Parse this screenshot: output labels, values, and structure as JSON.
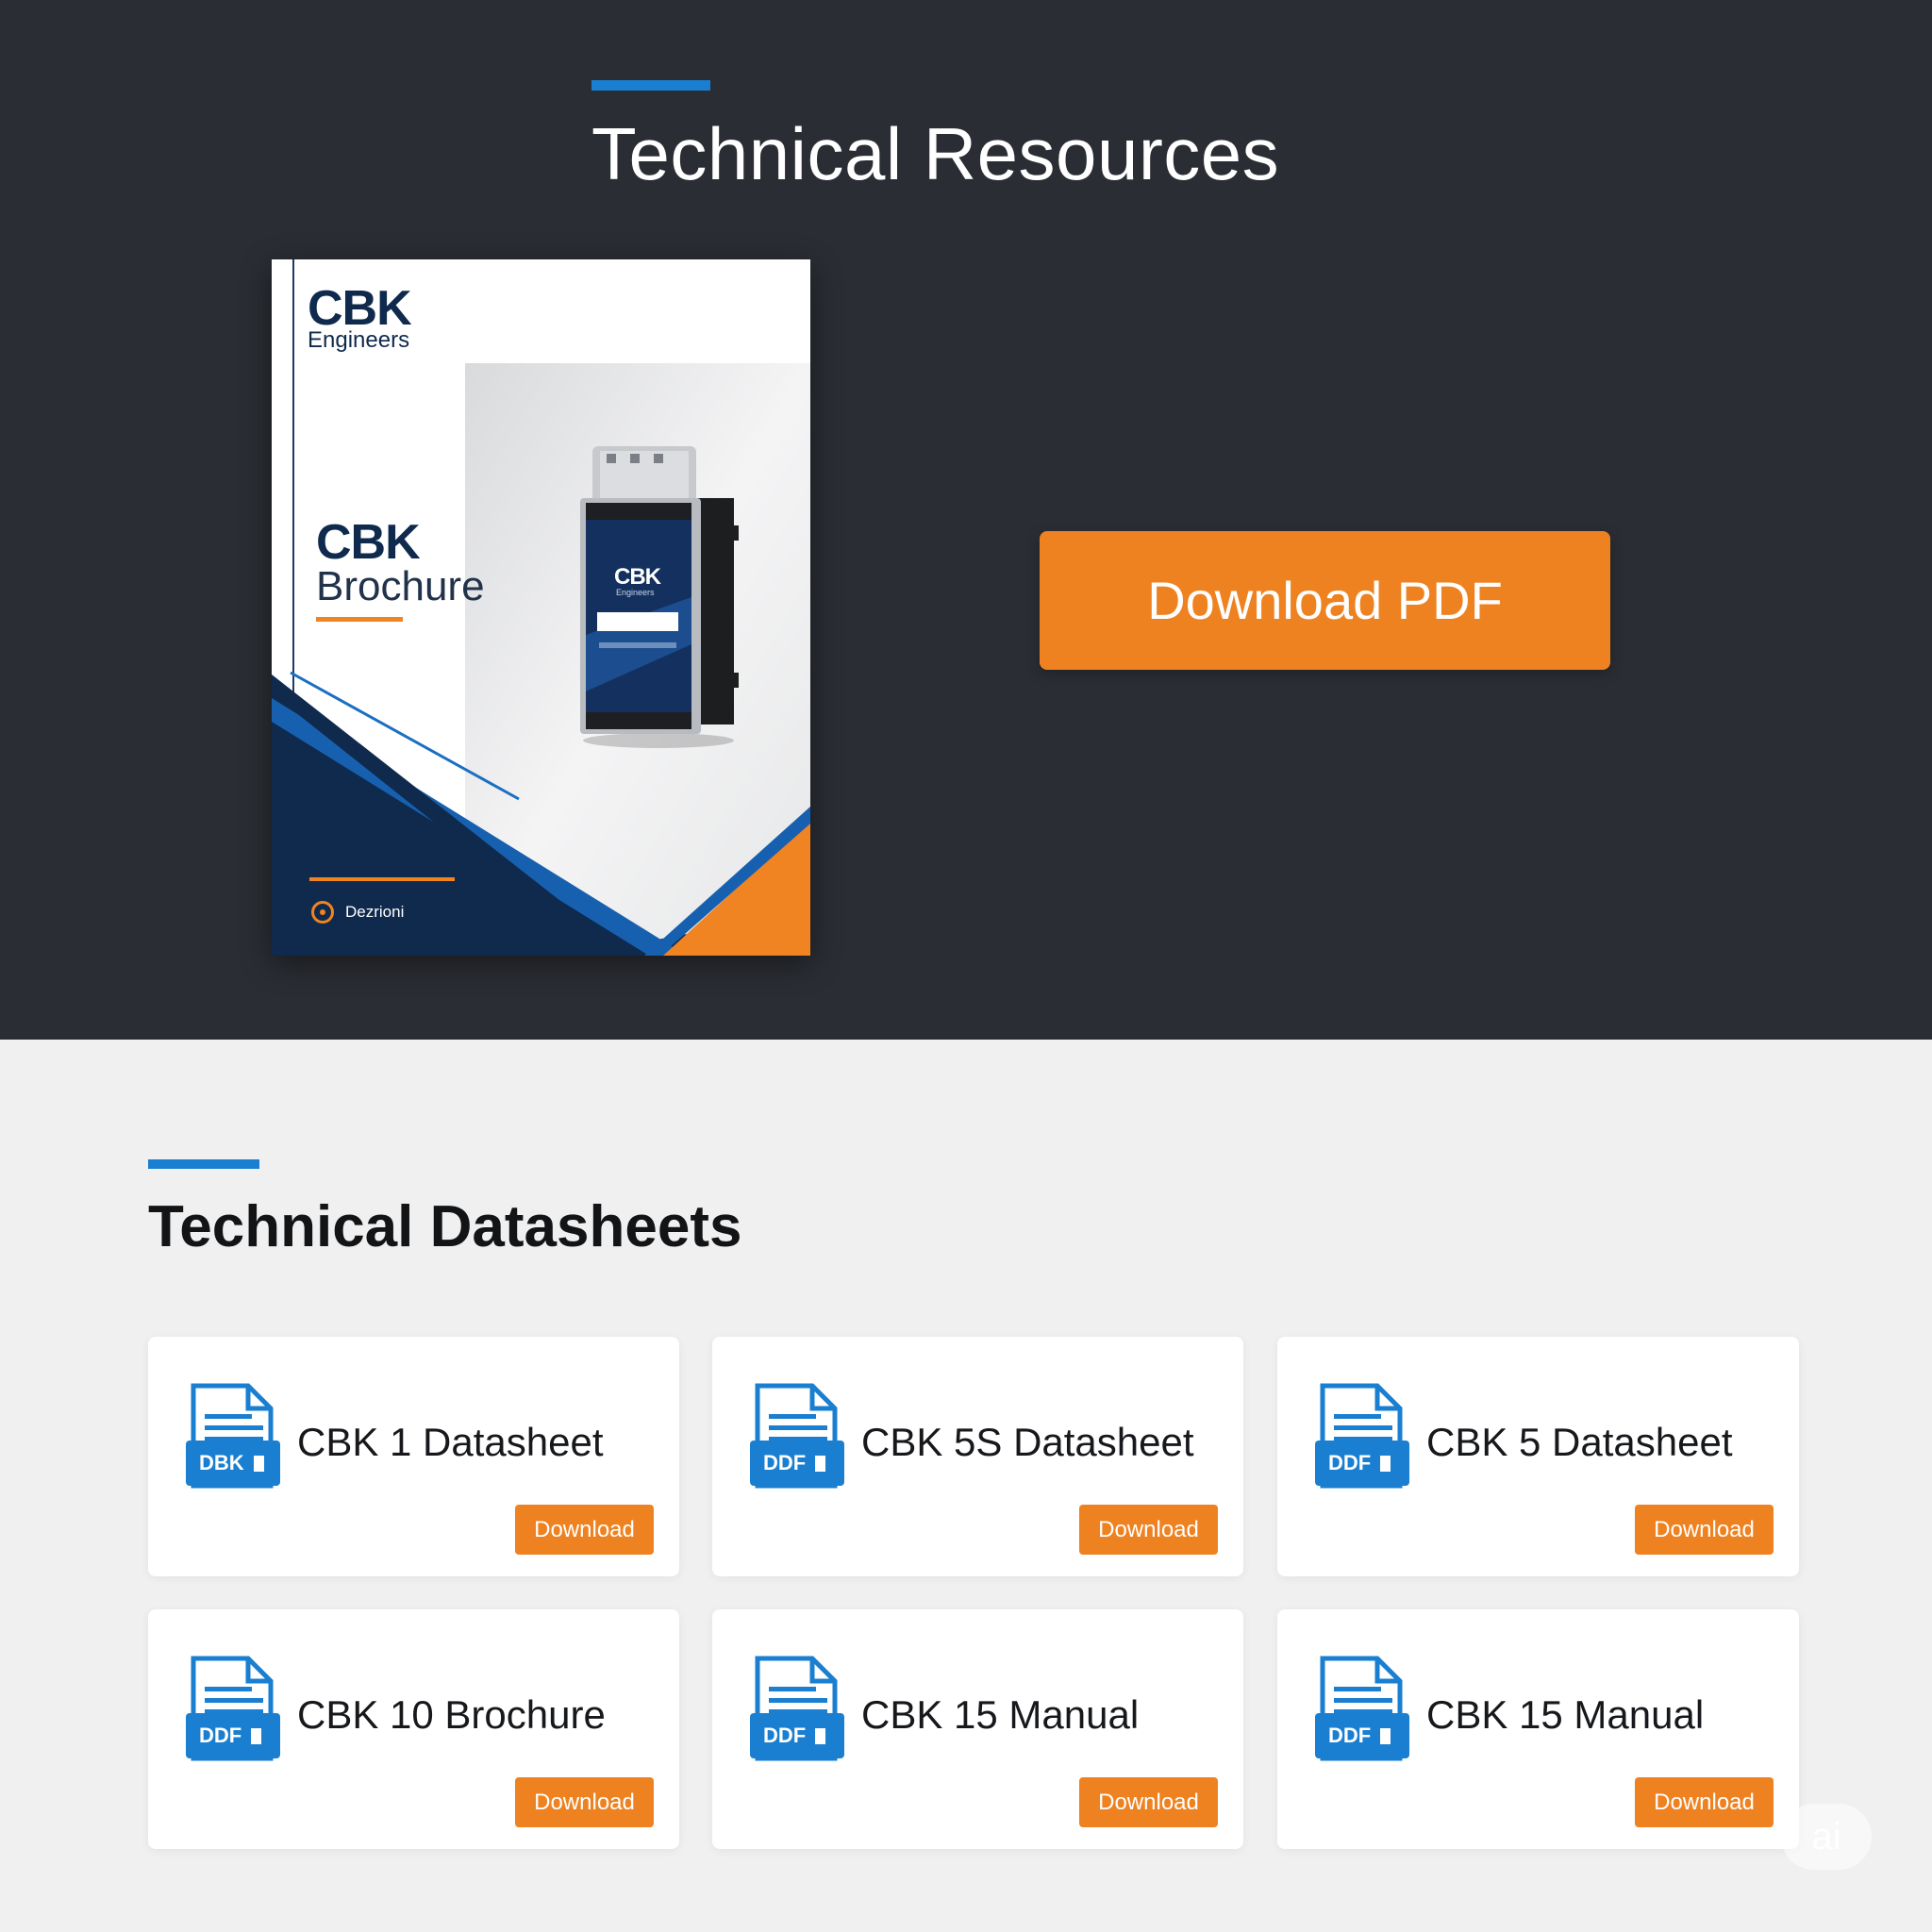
{
  "hero": {
    "title": "Technical Resources",
    "download_pdf_label": "Download PDF",
    "brochure": {
      "brand_name": "CBK",
      "brand_sub": "Engineers",
      "title_line1": "CBK",
      "title_line2": "Brochure",
      "footer_text": "Dezrioni",
      "device_label": "CBK",
      "device_sub": "Engineers"
    }
  },
  "datasheets": {
    "title": "Technical Datasheets",
    "cards": [
      {
        "title": "CBK 1 Datasheet",
        "file_tag": "DBK",
        "button": "Download"
      },
      {
        "title": "CBK 5S Datasheet",
        "file_tag": "DDF",
        "button": "Download"
      },
      {
        "title": "CBK 5 Datasheet",
        "file_tag": "DDF",
        "button": "Download"
      },
      {
        "title": "CBK 10 Brochure",
        "file_tag": "DDF",
        "button": "Download"
      },
      {
        "title": "CBK 15 Manual",
        "file_tag": "DDF",
        "button": "Download"
      },
      {
        "title": "CBK 15 Manual",
        "file_tag": "DDF",
        "button": "Download"
      }
    ]
  },
  "badge": "ai",
  "colors": {
    "hero_bg": "#2a2d33",
    "accent_blue": "#1a7fd0",
    "accent_orange": "#ef8220",
    "navy": "#0f2a4d",
    "page_bg": "#f0f0f1"
  },
  "icons": [
    "pdf-file-icon",
    "cbk-device-image"
  ]
}
